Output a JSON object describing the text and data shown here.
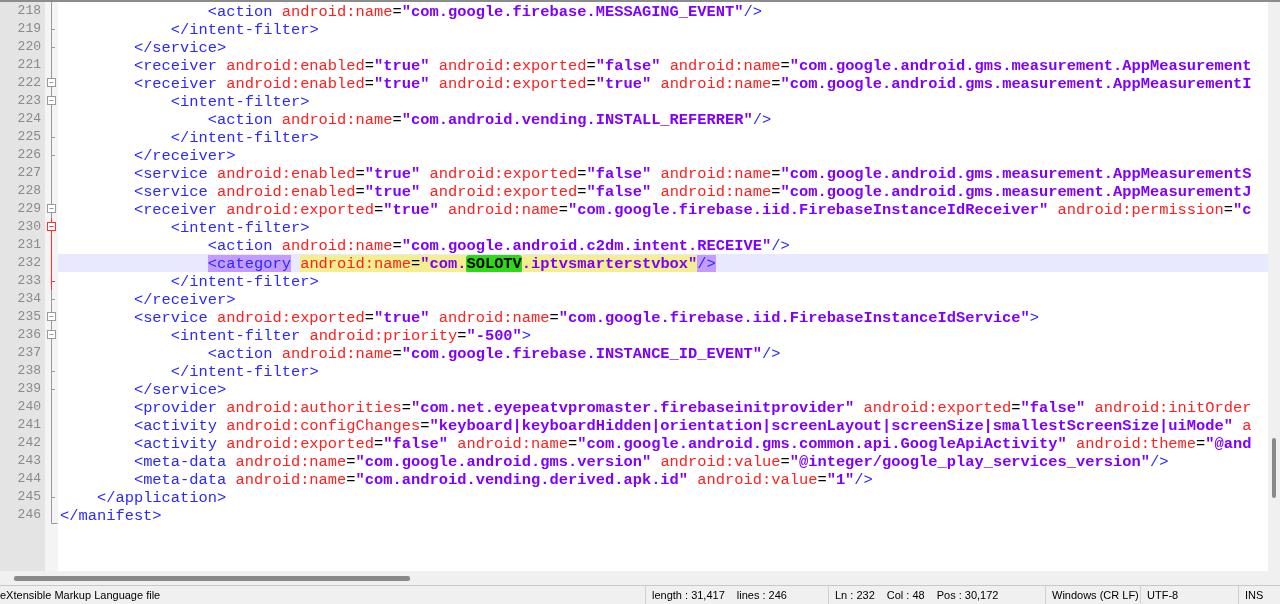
{
  "editor": {
    "lines": [
      {
        "number": "218",
        "kind": "line",
        "fold_current": false,
        "current": false,
        "tokens": [
          {
            "kind": "tag",
            "text": "                <action"
          },
          {
            "kind": "attr",
            "text": "android:name"
          },
          {
            "kind": "eq",
            "text": "="
          },
          {
            "kind": "value",
            "text": "\"com.google.firebase.MESSAGING_EVENT\""
          },
          {
            "kind": "close",
            "text": "/>"
          }
        ]
      },
      {
        "number": "219",
        "kind": "end",
        "fold_current": false,
        "current": false,
        "tokens": [
          {
            "kind": "tag",
            "text": "            </intent-filter>"
          }
        ]
      },
      {
        "number": "220",
        "kind": "end",
        "fold_current": false,
        "current": false,
        "tokens": [
          {
            "kind": "tag",
            "text": "        </service>"
          }
        ]
      },
      {
        "number": "221",
        "kind": "line",
        "fold_current": false,
        "current": false,
        "tokens": [
          {
            "kind": "tag",
            "text": "        <receiver"
          },
          {
            "kind": "attr",
            "text": "android:enabled"
          },
          {
            "kind": "eq",
            "text": "="
          },
          {
            "kind": "value",
            "text": "\"true\""
          },
          {
            "kind": "attr",
            "text": "android:exported"
          },
          {
            "kind": "eq",
            "text": "="
          },
          {
            "kind": "value",
            "text": "\"false\""
          },
          {
            "kind": "attr",
            "text": "android:name"
          },
          {
            "kind": "eq",
            "text": "="
          },
          {
            "kind": "value",
            "text": "\"com.google.android.gms.measurement.AppMeasurement"
          }
        ]
      },
      {
        "number": "222",
        "kind": "box",
        "fold_current": false,
        "current": false,
        "tokens": [
          {
            "kind": "tag",
            "text": "        <receiver"
          },
          {
            "kind": "attr",
            "text": "android:enabled"
          },
          {
            "kind": "eq",
            "text": "="
          },
          {
            "kind": "value",
            "text": "\"true\""
          },
          {
            "kind": "attr",
            "text": "android:exported"
          },
          {
            "kind": "eq",
            "text": "="
          },
          {
            "kind": "value",
            "text": "\"true\""
          },
          {
            "kind": "attr",
            "text": "android:name"
          },
          {
            "kind": "eq",
            "text": "="
          },
          {
            "kind": "value",
            "text": "\"com.google.android.gms.measurement.AppMeasurementI"
          }
        ]
      },
      {
        "number": "223",
        "kind": "box",
        "fold_current": false,
        "current": false,
        "tokens": [
          {
            "kind": "tag",
            "text": "            <intent-filter>"
          }
        ]
      },
      {
        "number": "224",
        "kind": "line",
        "fold_current": false,
        "current": false,
        "tokens": [
          {
            "kind": "tag",
            "text": "                <action"
          },
          {
            "kind": "attr",
            "text": "android:name"
          },
          {
            "kind": "eq",
            "text": "="
          },
          {
            "kind": "value",
            "text": "\"com.android.vending.INSTALL_REFERRER\""
          },
          {
            "kind": "close",
            "text": "/>"
          }
        ]
      },
      {
        "number": "225",
        "kind": "end",
        "fold_current": false,
        "current": false,
        "tokens": [
          {
            "kind": "tag",
            "text": "            </intent-filter>"
          }
        ]
      },
      {
        "number": "226",
        "kind": "end",
        "fold_current": false,
        "current": false,
        "tokens": [
          {
            "kind": "tag",
            "text": "        </receiver>"
          }
        ]
      },
      {
        "number": "227",
        "kind": "line",
        "fold_current": false,
        "current": false,
        "tokens": [
          {
            "kind": "tag",
            "text": "        <service"
          },
          {
            "kind": "attr",
            "text": "android:enabled"
          },
          {
            "kind": "eq",
            "text": "="
          },
          {
            "kind": "value",
            "text": "\"true\""
          },
          {
            "kind": "attr",
            "text": "android:exported"
          },
          {
            "kind": "eq",
            "text": "="
          },
          {
            "kind": "value",
            "text": "\"false\""
          },
          {
            "kind": "attr",
            "text": "android:name"
          },
          {
            "kind": "eq",
            "text": "="
          },
          {
            "kind": "value",
            "text": "\"com.google.android.gms.measurement.AppMeasurementS"
          }
        ]
      },
      {
        "number": "228",
        "kind": "line",
        "fold_current": false,
        "current": false,
        "tokens": [
          {
            "kind": "tag",
            "text": "        <service"
          },
          {
            "kind": "attr",
            "text": "android:enabled"
          },
          {
            "kind": "eq",
            "text": "="
          },
          {
            "kind": "value",
            "text": "\"true\""
          },
          {
            "kind": "attr",
            "text": "android:exported"
          },
          {
            "kind": "eq",
            "text": "="
          },
          {
            "kind": "value",
            "text": "\"false\""
          },
          {
            "kind": "attr",
            "text": "android:name"
          },
          {
            "kind": "eq",
            "text": "="
          },
          {
            "kind": "value",
            "text": "\"com.google.android.gms.measurement.AppMeasurementJ"
          }
        ]
      },
      {
        "number": "229",
        "kind": "box",
        "fold_current": false,
        "current": false,
        "tokens": [
          {
            "kind": "tag",
            "text": "        <receiver"
          },
          {
            "kind": "attr",
            "text": "android:exported"
          },
          {
            "kind": "eq",
            "text": "="
          },
          {
            "kind": "value",
            "text": "\"true\""
          },
          {
            "kind": "attr",
            "text": "android:name"
          },
          {
            "kind": "eq",
            "text": "="
          },
          {
            "kind": "value",
            "text": "\"com.google.firebase.iid.FirebaseInstanceIdReceiver\""
          },
          {
            "kind": "attr",
            "text": "android:permission"
          },
          {
            "kind": "eq",
            "text": "="
          },
          {
            "kind": "value",
            "text": "\"c"
          }
        ]
      },
      {
        "number": "230",
        "kind": "box",
        "fold_current": true,
        "current": false,
        "tokens": [
          {
            "kind": "tag",
            "text": "            <intent-filter>"
          }
        ]
      },
      {
        "number": "231",
        "kind": "line",
        "fold_current": true,
        "current": false,
        "tokens": [
          {
            "kind": "tag",
            "text": "                <action"
          },
          {
            "kind": "attr",
            "text": "android:name"
          },
          {
            "kind": "eq",
            "text": "="
          },
          {
            "kind": "value",
            "text": "\"com.google.android.c2dm.intent.RECEIVE\""
          },
          {
            "kind": "close",
            "text": "/>"
          }
        ]
      },
      {
        "number": "232",
        "kind": "line",
        "fold_current": true,
        "current": true,
        "tokens": [
          {
            "kind": "tag",
            "text": "                <category",
            "color": "#c49cff"
          },
          {
            "kind": "attr",
            "text": "android:name",
            "color": "#f3ef8f"
          },
          {
            "kind": "eq",
            "text": "=",
            "color": "#f3ef8f"
          },
          {
            "kind": "value",
            "text": "\"com.",
            "color": "#f3ef8f"
          },
          {
            "kind": "value",
            "text": "SOLOTV",
            "color": "#2ed915",
            "marked": true
          },
          {
            "kind": "value",
            "text": ".iptvsmarterstvbox\"",
            "color": "#f3ef8f"
          },
          {
            "kind": "close",
            "text": "/>",
            "color": "#c49cff"
          }
        ]
      },
      {
        "number": "233",
        "kind": "end",
        "fold_current": true,
        "current": false,
        "tokens": [
          {
            "kind": "tag",
            "text": "            </intent-filter>"
          }
        ]
      },
      {
        "number": "234",
        "kind": "end",
        "fold_current": false,
        "current": false,
        "tokens": [
          {
            "kind": "tag",
            "text": "        </receiver>"
          }
        ]
      },
      {
        "number": "235",
        "kind": "box",
        "fold_current": false,
        "current": false,
        "tokens": [
          {
            "kind": "tag",
            "text": "        <service"
          },
          {
            "kind": "attr",
            "text": "android:exported"
          },
          {
            "kind": "eq",
            "text": "="
          },
          {
            "kind": "value",
            "text": "\"true\""
          },
          {
            "kind": "attr",
            "text": "android:name"
          },
          {
            "kind": "eq",
            "text": "="
          },
          {
            "kind": "value",
            "text": "\"com.google.firebase.iid.FirebaseInstanceIdService\""
          },
          {
            "kind": "close",
            "text": ">"
          }
        ]
      },
      {
        "number": "236",
        "kind": "box",
        "fold_current": false,
        "current": false,
        "tokens": [
          {
            "kind": "tag",
            "text": "            <intent-filter"
          },
          {
            "kind": "attr",
            "text": "android:priority"
          },
          {
            "kind": "eq",
            "text": "="
          },
          {
            "kind": "value",
            "text": "\"-500\""
          },
          {
            "kind": "close",
            "text": ">"
          }
        ]
      },
      {
        "number": "237",
        "kind": "line",
        "fold_current": false,
        "current": false,
        "tokens": [
          {
            "kind": "tag",
            "text": "                <action"
          },
          {
            "kind": "attr",
            "text": "android:name"
          },
          {
            "kind": "eq",
            "text": "="
          },
          {
            "kind": "value",
            "text": "\"com.google.firebase.INSTANCE_ID_EVENT\""
          },
          {
            "kind": "close",
            "text": "/>"
          }
        ]
      },
      {
        "number": "238",
        "kind": "end",
        "fold_current": false,
        "current": false,
        "tokens": [
          {
            "kind": "tag",
            "text": "            </intent-filter>"
          }
        ]
      },
      {
        "number": "239",
        "kind": "end",
        "fold_current": false,
        "current": false,
        "tokens": [
          {
            "kind": "tag",
            "text": "        </service>"
          }
        ]
      },
      {
        "number": "240",
        "kind": "line",
        "fold_current": false,
        "current": false,
        "tokens": [
          {
            "kind": "tag",
            "text": "        <provider"
          },
          {
            "kind": "attr",
            "text": "android:authorities"
          },
          {
            "kind": "eq",
            "text": "="
          },
          {
            "kind": "value",
            "text": "\"com.net.eyepeatvpromaster.firebaseinitprovider\""
          },
          {
            "kind": "attr",
            "text": "android:exported"
          },
          {
            "kind": "eq",
            "text": "="
          },
          {
            "kind": "value",
            "text": "\"false\""
          },
          {
            "kind": "attr",
            "text": "android:initOrder"
          }
        ]
      },
      {
        "number": "241",
        "kind": "line",
        "fold_current": false,
        "current": false,
        "tokens": [
          {
            "kind": "tag",
            "text": "        <activity"
          },
          {
            "kind": "attr",
            "text": "android:configChanges"
          },
          {
            "kind": "eq",
            "text": "="
          },
          {
            "kind": "value",
            "text": "\"keyboard|keyboardHidden|orientation|screenLayout|screenSize|smallestScreenSize|uiMode\""
          },
          {
            "kind": "attr",
            "text": "a"
          }
        ]
      },
      {
        "number": "242",
        "kind": "line",
        "fold_current": false,
        "current": false,
        "tokens": [
          {
            "kind": "tag",
            "text": "        <activity"
          },
          {
            "kind": "attr",
            "text": "android:exported"
          },
          {
            "kind": "eq",
            "text": "="
          },
          {
            "kind": "value",
            "text": "\"false\""
          },
          {
            "kind": "attr",
            "text": "android:name"
          },
          {
            "kind": "eq",
            "text": "="
          },
          {
            "kind": "value",
            "text": "\"com.google.android.gms.common.api.GoogleApiActivity\""
          },
          {
            "kind": "attr",
            "text": "android:theme"
          },
          {
            "kind": "eq",
            "text": "="
          },
          {
            "kind": "value",
            "text": "\"@and"
          }
        ]
      },
      {
        "number": "243",
        "kind": "line",
        "fold_current": false,
        "current": false,
        "tokens": [
          {
            "kind": "tag",
            "text": "        <meta-data"
          },
          {
            "kind": "attr",
            "text": "android:name"
          },
          {
            "kind": "eq",
            "text": "="
          },
          {
            "kind": "value",
            "text": "\"com.google.android.gms.version\""
          },
          {
            "kind": "attr",
            "text": "android:value"
          },
          {
            "kind": "eq",
            "text": "="
          },
          {
            "kind": "value",
            "text": "\"@integer/google_play_services_version\""
          },
          {
            "kind": "close",
            "text": "/>"
          }
        ]
      },
      {
        "number": "244",
        "kind": "line",
        "fold_current": false,
        "current": false,
        "tokens": [
          {
            "kind": "tag",
            "text": "        <meta-data"
          },
          {
            "kind": "attr",
            "text": "android:name"
          },
          {
            "kind": "eq",
            "text": "="
          },
          {
            "kind": "value",
            "text": "\"com.android.vending.derived.apk.id\""
          },
          {
            "kind": "attr",
            "text": "android:value"
          },
          {
            "kind": "eq",
            "text": "="
          },
          {
            "kind": "value",
            "text": "\"1\""
          },
          {
            "kind": "close",
            "text": "/>"
          }
        ]
      },
      {
        "number": "245",
        "kind": "end",
        "fold_current": false,
        "current": false,
        "tokens": [
          {
            "kind": "tag",
            "text": "    </application>"
          }
        ]
      },
      {
        "number": "246",
        "kind": "last",
        "fold_current": false,
        "current": false,
        "tokens": [
          {
            "kind": "tag",
            "text": "</manifest>"
          }
        ]
      }
    ]
  },
  "status_bar": {
    "file_type": "eXtensible Markup Language file",
    "length": "length : 31,417",
    "lines": "lines : 246",
    "ln": "Ln : 232",
    "col": "Col : 48",
    "pos": "Pos : 30,172",
    "eol": "Windows (CR LF)",
    "encoding": "UTF-8",
    "mode": "INS"
  }
}
